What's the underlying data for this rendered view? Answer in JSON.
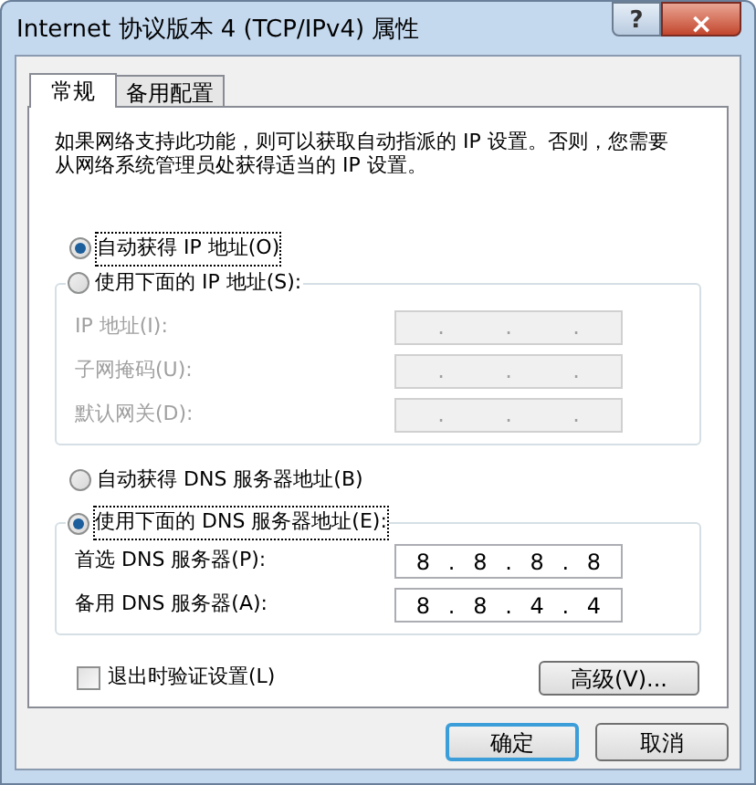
{
  "window": {
    "title": "Internet 协议版本 4 (TCP/IPv4) 属性",
    "controls": [
      "?",
      "×"
    ]
  },
  "tabs": [
    {
      "label": "常规",
      "selected": true
    },
    {
      "label": "备用配置",
      "selected": false
    }
  ],
  "description": "如果网络支持此功能，则可以获取自动指派的 IP 设置。否则，您需要从网络系统管理员处获得适当的 IP 设置。",
  "ip_mode": [
    {
      "label": "自动获得 IP 地址(O)",
      "selected": true
    },
    {
      "label": "使用下面的 IP 地址(S):",
      "selected": false
    }
  ],
  "ip_fields": [
    {
      "label": "IP 地址(I):",
      "disabled": true,
      "parts": [
        ".",
        ".",
        "."
      ]
    },
    {
      "label": "子网掩码(U):",
      "disabled": true,
      "parts": [
        ".",
        ".",
        "."
      ]
    },
    {
      "label": "默认网关(D):",
      "disabled": true,
      "parts": [
        ".",
        ".",
        "."
      ]
    }
  ],
  "dns_mode": [
    {
      "label": "自动获得 DNS 服务器地址(B)",
      "selected": false
    },
    {
      "label": "使用下面的 DNS 服务器地址(E):",
      "selected": true
    }
  ],
  "dns_fields": [
    {
      "label": "首选 DNS 服务器(P):",
      "disabled": false,
      "parts": [
        "8",
        ".",
        "8",
        ".",
        "8",
        ".",
        "8"
      ]
    },
    {
      "label": "备用 DNS 服务器(A):",
      "disabled": false,
      "parts": [
        "8",
        ".",
        "8",
        ".",
        "4",
        ".",
        "4"
      ]
    }
  ],
  "validate": {
    "label": "退出时验证设置(L)",
    "checked": false
  },
  "advanced_button": "高级(V)...",
  "buttons": [
    {
      "label": "确定",
      "default": true
    },
    {
      "label": "取消",
      "default": false
    }
  ]
}
